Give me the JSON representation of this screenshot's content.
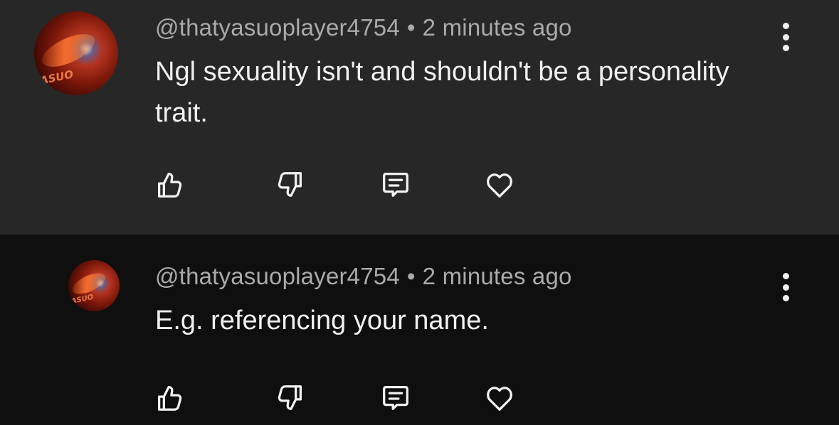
{
  "comments": [
    {
      "author": "@thatyasuoplayer4754",
      "separator": "•",
      "time": "2 minutes ago",
      "text": "Ngl sexuality isn't and shouldn't be a personality trait.",
      "avatar_text": "ASUO",
      "icons": {
        "like": "thumbs-up-icon",
        "dislike": "thumbs-down-icon",
        "reply": "reply-comment-icon",
        "heart": "heart-icon",
        "more": "more-vertical-icon"
      }
    },
    {
      "author": "@thatyasuoplayer4754",
      "separator": "•",
      "time": "2 minutes ago",
      "text": "E.g. referencing your name.",
      "avatar_text": "ASUO",
      "icons": {
        "like": "thumbs-up-icon",
        "dislike": "thumbs-down-icon",
        "reply": "reply-comment-icon",
        "heart": "heart-icon",
        "more": "more-vertical-icon"
      }
    }
  ],
  "colors": {
    "top_comment_bg": "#272727",
    "reply_bg": "#0f0f0f",
    "meta_text": "#aaaaaa",
    "body_text": "#f1f1f1"
  }
}
